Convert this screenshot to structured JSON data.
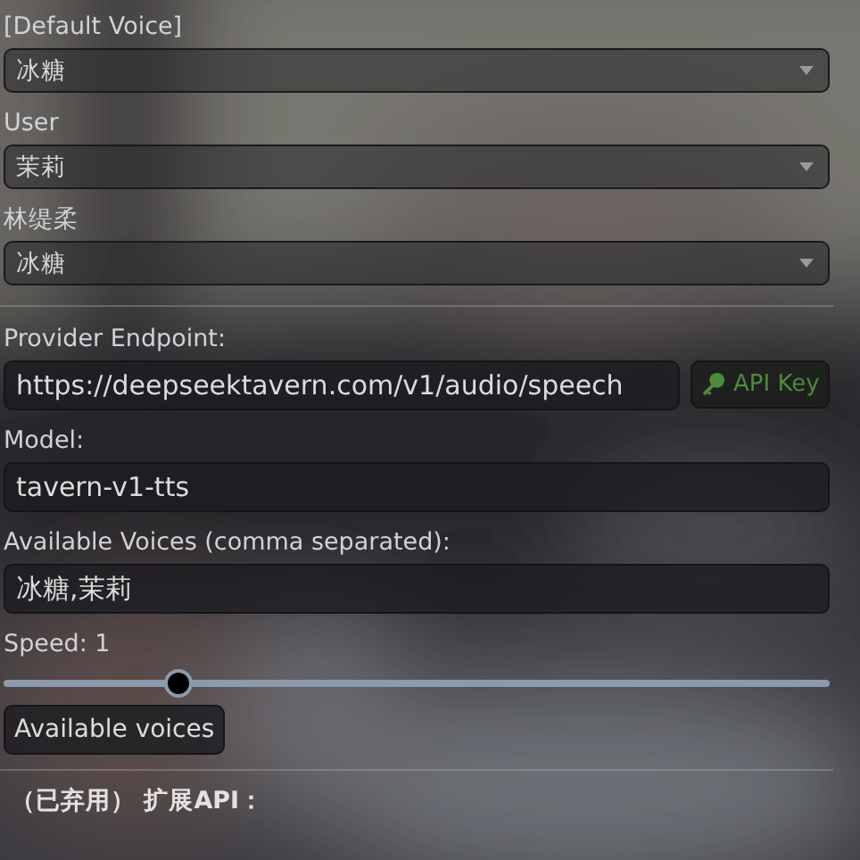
{
  "voice_map": [
    {
      "label": "[Default Voice]",
      "value": "冰糖"
    },
    {
      "label": "User",
      "value": "茉莉"
    },
    {
      "label": "林缇柔",
      "value": "冰糖"
    }
  ],
  "provider": {
    "endpoint_label": "Provider Endpoint:",
    "endpoint": "https://deepseektavern.com/v1/audio/speech",
    "api_key_button": "API Key",
    "model_label": "Model:",
    "model": "tavern-v1-tts",
    "voices_label": "Available Voices (comma separated):",
    "voices": "冰糖,茉莉",
    "speed_label": "Speed: 1",
    "speed": {
      "level": 0.21
    },
    "voices_button": "Available voices"
  },
  "deprecated_heading": "（已弃用） 扩展API："
}
